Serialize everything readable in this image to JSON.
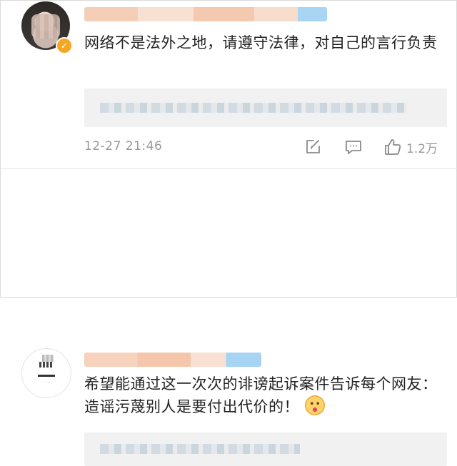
{
  "comments": [
    {
      "text": "网络不是法外之地，请遵守法律，对自己的言行负责",
      "time": "12-27 21:46",
      "likes": "1.2万",
      "verified": true,
      "icons": [
        "share-icon",
        "reply-icon",
        "like-icon"
      ]
    },
    {
      "text": "希望能通过这一次次的诽谤起诉案件告诉每个网友：造谣污蔑别人是要付出代价的！",
      "emoji": "smiling-face-emoji"
    }
  ],
  "colors": {
    "verify_badge": "#f5a623",
    "meta_text": "#9a9a9a",
    "reply_bg": "#f1f1f1"
  }
}
